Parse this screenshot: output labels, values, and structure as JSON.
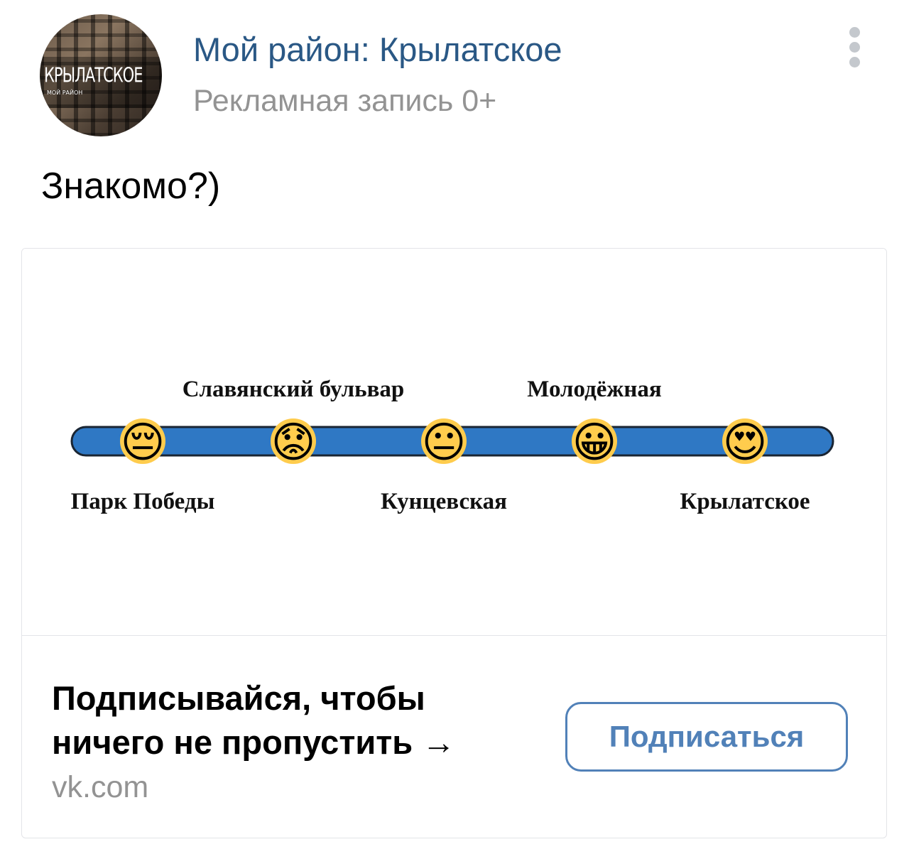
{
  "header": {
    "avatar": {
      "title": "КРЫЛАТСКОЕ",
      "subtitle": "МОЙ РАЙОН"
    },
    "group_name": "Мой район: Крылатское",
    "post_label": "Рекламная запись 0+",
    "menu_icon": "more-vertical-icon"
  },
  "post": {
    "text": "Знакомо?)"
  },
  "attachment": {
    "line_color": "#2f78c4",
    "stations": [
      {
        "name": "Парк Победы",
        "emoji": "😔",
        "label_side": "below"
      },
      {
        "name": "Славянский бульвар",
        "emoji": "😟",
        "label_side": "above"
      },
      {
        "name": "Кунцевская",
        "emoji": "😐",
        "label_side": "below"
      },
      {
        "name": "Молодёжная",
        "emoji": "😀",
        "label_side": "above"
      },
      {
        "name": "Крылатское",
        "emoji": "😍",
        "label_side": "below"
      }
    ],
    "cta": {
      "text": "Подписывайся, чтобы ничего не пропустить →",
      "domain": "vk.com",
      "button_label": "Подписаться"
    }
  },
  "colors": {
    "link": "#2a5885",
    "secondary_text": "#939393",
    "button_accent": "#5181b8"
  }
}
